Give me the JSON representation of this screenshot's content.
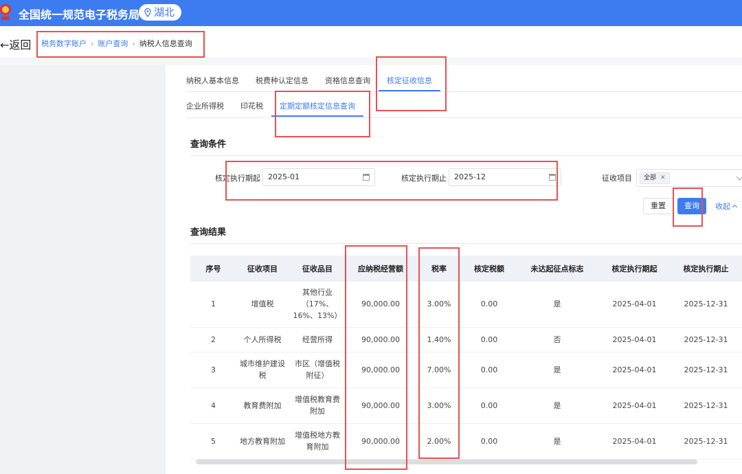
{
  "header": {
    "title": "全国统一规范电子税务局",
    "region": "湖北",
    "region_icon": "location-icon"
  },
  "nav": {
    "back_label": "←返回",
    "breadcrumb": [
      "税务数字账户",
      "账户查询",
      "纳税人信息查询"
    ]
  },
  "tabs_primary": [
    "纳税人基本信息",
    "税费种认定信息",
    "资格信息查询",
    "核定征收信息"
  ],
  "tabs_secondary": [
    "企业所得税",
    "印花税",
    "定期定额核定信息查询"
  ],
  "query": {
    "title": "查询条件",
    "start_label": "核定执行期起",
    "start_value": "2025-01",
    "end_label": "核定执行期止",
    "end_value": "2025-12",
    "item_label": "征收项目",
    "item_tag": "全部",
    "reset_label": "重置",
    "query_label": "查询",
    "collapse_label": "收起"
  },
  "results": {
    "title": "查询结果",
    "headers": [
      "序号",
      "征收项目",
      "征收品目",
      "应纳税经营额",
      "税率",
      "核定税额",
      "未达起征点标志",
      "核定执行期起",
      "核定执行期止"
    ],
    "rows": [
      [
        "1",
        "增值税",
        "其他行业（17%、16%、13%）",
        "90,000.00",
        "3.00%",
        "0.00",
        "是",
        "2025-04-01",
        "2025-12-31"
      ],
      [
        "2",
        "个人所得税",
        "经营所得",
        "90,000.00",
        "1.40%",
        "0.00",
        "否",
        "2025-04-01",
        "2025-12-31"
      ],
      [
        "3",
        "城市维护建设税",
        "市区（增值税附征）",
        "90,000.00",
        "7.00%",
        "0.00",
        "是",
        "2025-04-01",
        "2025-12-31"
      ],
      [
        "4",
        "教育费附加",
        "增值税教育费附加",
        "90,000.00",
        "3.00%",
        "0.00",
        "是",
        "2025-04-01",
        "2025-12-31"
      ],
      [
        "5",
        "地方教育附加",
        "增值税地方教育附加",
        "90,000.00",
        "2.00%",
        "0.00",
        "是",
        "2025-04-01",
        "2025-12-31"
      ]
    ]
  },
  "colors": {
    "primary": "#3d7bf0",
    "annotation": "#e85050"
  }
}
